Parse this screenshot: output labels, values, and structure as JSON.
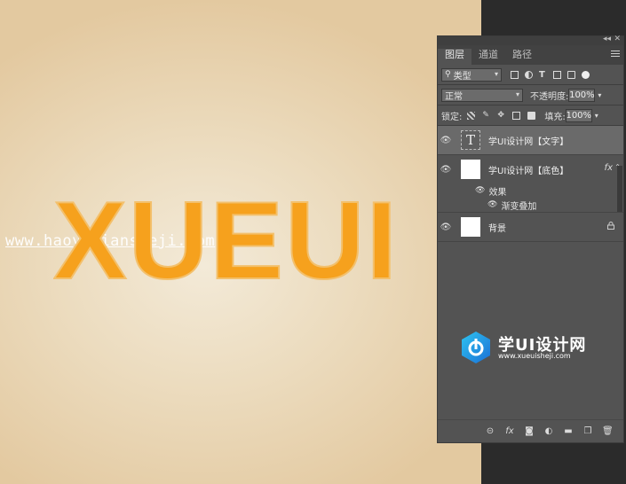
{
  "canvas": {
    "watermark": "www.haoyidiansheji.com",
    "big_text": "XUEUI",
    "text_color": "#f6a11d"
  },
  "layers_panel": {
    "tabs": [
      {
        "label": "图层",
        "active": true
      },
      {
        "label": "通道",
        "active": false
      },
      {
        "label": "路径",
        "active": false
      }
    ],
    "filter_type": "类型",
    "blend_mode": "正常",
    "opacity_label": "不透明度:",
    "opacity_value": "100%",
    "lock_label": "锁定:",
    "fill_label": "填充:",
    "fill_value": "100%",
    "layers": [
      {
        "name": "学UI设计网【文字】",
        "type": "text",
        "selected": true
      },
      {
        "name": "学UI设计网【底色】",
        "type": "pixel",
        "has_fx": true,
        "fx_label": "fx"
      },
      {
        "name": "背景",
        "type": "background",
        "locked": true
      }
    ],
    "effects_label": "效果",
    "effect_item": "渐变叠加",
    "footer_icons": [
      "link-icon",
      "fx-icon",
      "mask-icon",
      "adjustment-icon",
      "folder-icon",
      "new-layer-icon",
      "trash-icon"
    ]
  },
  "logo": {
    "title": "学UI设计网",
    "url": "www.xueuisheji.com"
  }
}
